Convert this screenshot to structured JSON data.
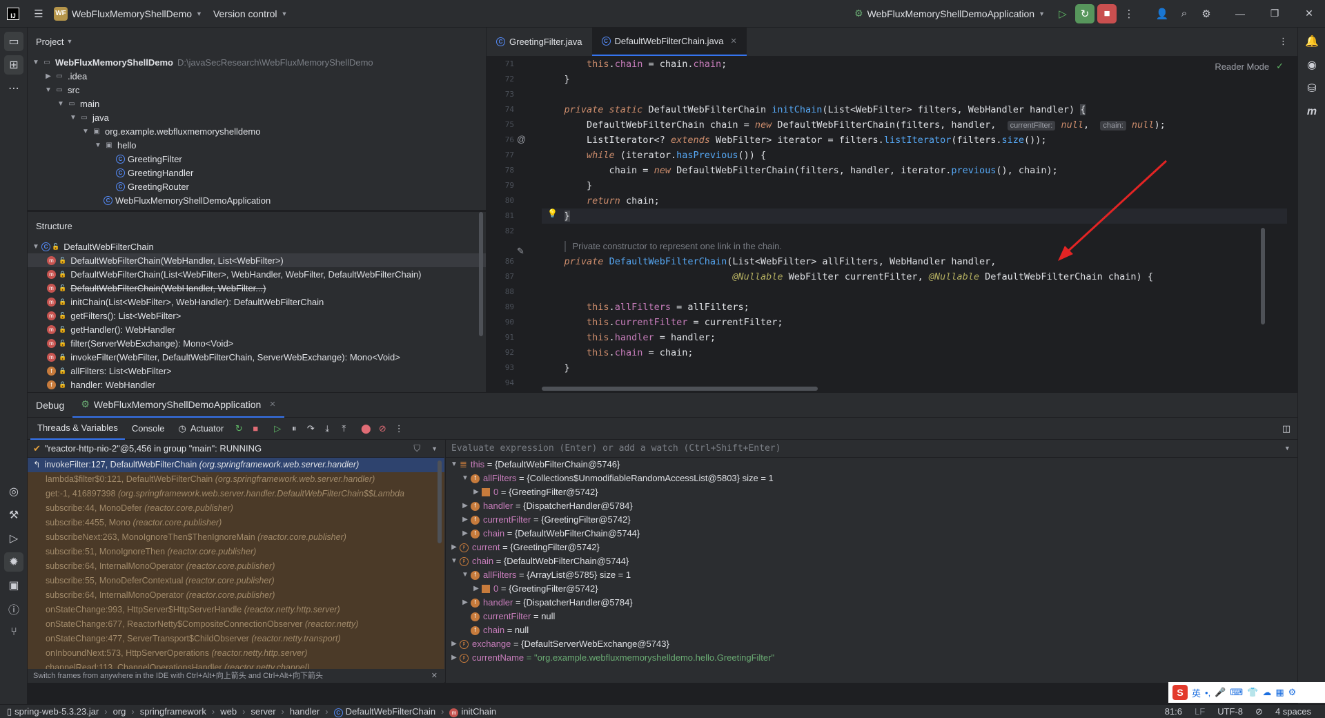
{
  "titlebar": {
    "logo": "IJ",
    "project_badge": "WF",
    "project_name": "WebFluxMemoryShellDemo",
    "vcs": "Version control",
    "run_config": "WebFluxMemoryShellDemoApplication"
  },
  "project": {
    "header": "Project",
    "tree": [
      {
        "label": "WebFluxMemoryShellDemo",
        "path": "D:\\javaSecResearch\\WebFluxMemoryShellDemo",
        "depth": 0,
        "arrow": "v",
        "icon": "module"
      },
      {
        "label": ".idea",
        "depth": 1,
        "arrow": ">",
        "icon": "folder"
      },
      {
        "label": "src",
        "depth": 1,
        "arrow": "v",
        "icon": "folder"
      },
      {
        "label": "main",
        "depth": 2,
        "arrow": "v",
        "icon": "folder"
      },
      {
        "label": "java",
        "depth": 3,
        "arrow": "v",
        "icon": "folder"
      },
      {
        "label": "org.example.webfluxmemoryshelldemo",
        "depth": 4,
        "arrow": "v",
        "icon": "package"
      },
      {
        "label": "hello",
        "depth": 5,
        "arrow": "v",
        "icon": "package"
      },
      {
        "label": "GreetingFilter",
        "depth": 6,
        "arrow": "",
        "icon": "class"
      },
      {
        "label": "GreetingHandler",
        "depth": 6,
        "arrow": "",
        "icon": "class"
      },
      {
        "label": "GreetingRouter",
        "depth": 6,
        "arrow": "",
        "icon": "class"
      },
      {
        "label": "WebFluxMemoryShellDemoApplication",
        "depth": 5,
        "arrow": "",
        "icon": "class"
      }
    ]
  },
  "structure": {
    "header": "Structure",
    "root": "DefaultWebFilterChain",
    "items": [
      {
        "label": "DefaultWebFilterChain(WebHandler, List<WebFilter>)",
        "kind": "m",
        "access": "public",
        "selected": true
      },
      {
        "label": "DefaultWebFilterChain(List<WebFilter>, WebHandler, WebFilter, DefaultWebFilterChain)",
        "kind": "m",
        "access": "private"
      },
      {
        "label": "DefaultWebFilterChain(WebHandler, WebFilter...)",
        "kind": "m",
        "access": "public",
        "deprecated": true
      },
      {
        "label": "initChain(List<WebFilter>, WebHandler): DefaultWebFilterChain",
        "kind": "m",
        "access": "private"
      },
      {
        "label": "getFilters(): List<WebFilter>",
        "kind": "m",
        "access": "public"
      },
      {
        "label": "getHandler(): WebHandler",
        "kind": "m",
        "access": "public"
      },
      {
        "label": "filter(ServerWebExchange): Mono<Void>",
        "kind": "m",
        "access": "public"
      },
      {
        "label": "invokeFilter(WebFilter, DefaultWebFilterChain, ServerWebExchange): Mono<Void>",
        "kind": "m",
        "access": "private"
      },
      {
        "label": "allFilters: List<WebFilter>",
        "kind": "f",
        "access": "private"
      },
      {
        "label": "handler: WebHandler",
        "kind": "f",
        "access": "private"
      }
    ]
  },
  "editor": {
    "tabs": [
      {
        "label": "GreetingFilter.java",
        "active": false
      },
      {
        "label": "DefaultWebFilterChain.java",
        "active": true
      }
    ],
    "reader_mode": "Reader Mode",
    "line_numbers": [
      "71",
      "72",
      "73",
      "74",
      "75",
      "76",
      "77",
      "78",
      "79",
      "80",
      "81",
      "82",
      "",
      "86",
      "87",
      "88",
      "89",
      "90",
      "91",
      "92",
      "93",
      "94"
    ],
    "doc_comment": "Private constructor to represent one link in the chain.",
    "hints": {
      "currentFilter": "currentFilter:",
      "chain": "chain:"
    }
  },
  "debug": {
    "tab_debug": "Debug",
    "tab_session": "WebFluxMemoryShellDemoApplication",
    "sub_tabs": [
      "Threads & Variables",
      "Console",
      "Actuator"
    ],
    "thread": "\"reactor-http-nio-2\"@5,456 in group \"main\": RUNNING",
    "frames": [
      {
        "method": "invokeFilter:127, DefaultWebFilterChain",
        "pkg": "(org.springframework.web.server.handler)",
        "type": "cur"
      },
      {
        "method": "lambda$filter$0:121, DefaultWebFilterChain",
        "pkg": "(org.springframework.web.server.handler)",
        "type": "lib"
      },
      {
        "method": "get:-1, 416897398",
        "pkg": "(org.springframework.web.server.handler.DefaultWebFilterChain$$Lambda",
        "type": "lib"
      },
      {
        "method": "subscribe:44, MonoDefer",
        "pkg": "(reactor.core.publisher)",
        "type": "lib"
      },
      {
        "method": "subscribe:4455, Mono",
        "pkg": "(reactor.core.publisher)",
        "type": "lib"
      },
      {
        "method": "subscribeNext:263, MonoIgnoreThen$ThenIgnoreMain",
        "pkg": "(reactor.core.publisher)",
        "type": "lib"
      },
      {
        "method": "subscribe:51, MonoIgnoreThen",
        "pkg": "(reactor.core.publisher)",
        "type": "lib"
      },
      {
        "method": "subscribe:64, InternalMonoOperator",
        "pkg": "(reactor.core.publisher)",
        "type": "lib"
      },
      {
        "method": "subscribe:55, MonoDeferContextual",
        "pkg": "(reactor.core.publisher)",
        "type": "lib"
      },
      {
        "method": "subscribe:64, InternalMonoOperator",
        "pkg": "(reactor.core.publisher)",
        "type": "lib"
      },
      {
        "method": "onStateChange:993, HttpServer$HttpServerHandle",
        "pkg": "(reactor.netty.http.server)",
        "type": "lib"
      },
      {
        "method": "onStateChange:677, ReactorNetty$CompositeConnectionObserver",
        "pkg": "(reactor.netty)",
        "type": "lib"
      },
      {
        "method": "onStateChange:477, ServerTransport$ChildObserver",
        "pkg": "(reactor.netty.transport)",
        "type": "lib"
      },
      {
        "method": "onInboundNext:573, HttpServerOperations",
        "pkg": "(reactor.netty.http.server)",
        "type": "lib"
      },
      {
        "method": "channelRead:113, ChannelOperationsHandler",
        "pkg": "(reactor.netty.channel)",
        "type": "lib"
      }
    ],
    "frames_hint": "Switch frames from anywhere in the IDE with Ctrl+Alt+向上箭头 and Ctrl+Alt+向下箭头",
    "eval_placeholder": "Evaluate expression (Enter) or add a watch (Ctrl+Shift+Enter)",
    "vars": [
      {
        "depth": 0,
        "arrow": "v",
        "icon": "stack",
        "name": "this",
        "value": "= {DefaultWebFilterChain@5746}"
      },
      {
        "depth": 1,
        "arrow": "v",
        "icon": "f",
        "name": "allFilters",
        "value": "= {Collections$UnmodifiableRandomAccessList@5803}  size = 1"
      },
      {
        "depth": 2,
        "arrow": ">",
        "icon": "arr",
        "name": "0",
        "value": "= {GreetingFilter@5742}"
      },
      {
        "depth": 1,
        "arrow": ">",
        "icon": "f",
        "name": "handler",
        "value": "= {DispatcherHandler@5784}"
      },
      {
        "depth": 1,
        "arrow": ">",
        "icon": "f",
        "name": "currentFilter",
        "value": "= {GreetingFilter@5742}"
      },
      {
        "depth": 1,
        "arrow": ">",
        "icon": "f",
        "name": "chain",
        "value": "= {DefaultWebFilterChain@5744}"
      },
      {
        "depth": 0,
        "arrow": ">",
        "icon": "p",
        "name": "current",
        "value": "= {GreetingFilter@5742}"
      },
      {
        "depth": 0,
        "arrow": "v",
        "icon": "p",
        "name": "chain",
        "value": "= {DefaultWebFilterChain@5744}"
      },
      {
        "depth": 1,
        "arrow": "v",
        "icon": "f",
        "name": "allFilters",
        "value": "= {ArrayList@5785}  size = 1"
      },
      {
        "depth": 2,
        "arrow": ">",
        "icon": "arr",
        "name": "0",
        "value": "= {GreetingFilter@5742}"
      },
      {
        "depth": 1,
        "arrow": ">",
        "icon": "f",
        "name": "handler",
        "value": "= {DispatcherHandler@5784}"
      },
      {
        "depth": 1,
        "arrow": "",
        "icon": "f",
        "name": "currentFilter",
        "value": "= null"
      },
      {
        "depth": 1,
        "arrow": "",
        "icon": "f",
        "name": "chain",
        "value": "= null"
      },
      {
        "depth": 0,
        "arrow": ">",
        "icon": "p",
        "name": "exchange",
        "value": "= {DefaultServerWebExchange@5743}"
      },
      {
        "depth": 0,
        "arrow": ">",
        "icon": "p",
        "name": "currentName",
        "value": "= \"org.example.webfluxmemoryshelldemo.hello.GreetingFilter\"",
        "string": true
      }
    ]
  },
  "statusbar": {
    "crumbs": [
      "spring-web-5.3.23.jar",
      "org",
      "springframework",
      "web",
      "server",
      "handler",
      "DefaultWebFilterChain",
      "initChain"
    ],
    "position": "81:6",
    "line_sep": "LF",
    "encoding": "UTF-8",
    "indent": "4 spaces"
  },
  "ime": {
    "logo": "S",
    "lang": "英"
  }
}
